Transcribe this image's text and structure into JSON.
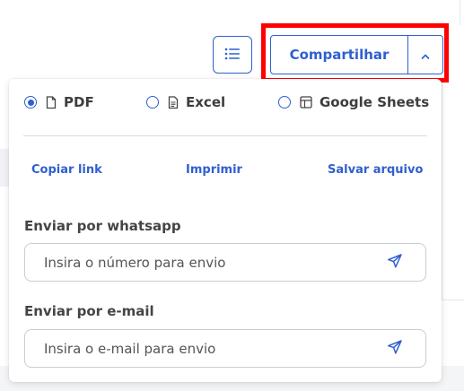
{
  "toolbar": {
    "share_label": "Compartilhar",
    "list_icon": "list-icon",
    "toggle_icon": "chevron-up-icon"
  },
  "share_menu": {
    "formats": [
      {
        "label": "PDF",
        "selected": true,
        "icon": "file-icon"
      },
      {
        "label": "Excel",
        "selected": false,
        "icon": "document-icon"
      },
      {
        "label": "Google Sheets",
        "selected": false,
        "icon": "table-icon"
      }
    ],
    "actions": [
      "Copiar link",
      "Imprimir",
      "Salvar arquivo"
    ],
    "whatsapp": {
      "label": "Enviar por whatsapp",
      "placeholder": "Insira o número para envio",
      "send_icon": "send-icon"
    },
    "email": {
      "label": "Enviar por e-mail",
      "placeholder": "Insira o e-mail para envio",
      "send_icon": "send-icon"
    }
  },
  "colors": {
    "accent": "#2f5fd0",
    "highlight": "#ff0000",
    "text": "#3d3d3d",
    "border": "#c9ccd3"
  }
}
